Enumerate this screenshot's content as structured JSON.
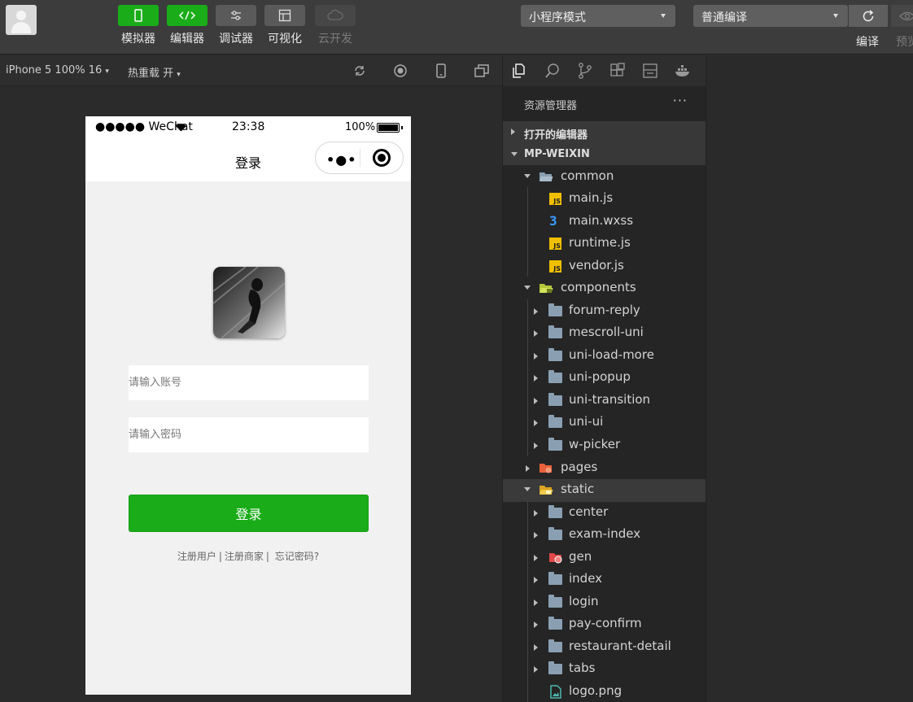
{
  "toolbar": {
    "buttons": [
      {
        "label": "模拟器"
      },
      {
        "label": "编辑器"
      },
      {
        "label": "调试器"
      },
      {
        "label": "可视化"
      },
      {
        "label": "云开发"
      }
    ],
    "mode_select": "小程序模式",
    "compile_select": "普通编译",
    "compile_label": "编译",
    "preview_label": "预览"
  },
  "simbar": {
    "device": "iPhone 5 100% 16",
    "hot_reload": "热重载 开"
  },
  "phone": {
    "status": {
      "carrier": "●●●●● WeChat",
      "time": "23:38",
      "battery": "100%"
    },
    "nav_title": "登录",
    "account_placeholder": "请输入账号",
    "password_placeholder": "请输入密码",
    "login_button": "登录",
    "links": [
      "注册用户",
      "注册商家",
      "忘记密码?"
    ]
  },
  "explorer": {
    "title": "资源管理器",
    "more": "···",
    "open_editors": "打开的编辑器",
    "project": "MP-WEIXIN",
    "tree": [
      {
        "name": "common"
      },
      {
        "name": "main.js"
      },
      {
        "name": "main.wxss"
      },
      {
        "name": "runtime.js"
      },
      {
        "name": "vendor.js"
      },
      {
        "name": "components"
      },
      {
        "name": "forum-reply"
      },
      {
        "name": "mescroll-uni"
      },
      {
        "name": "uni-load-more"
      },
      {
        "name": "uni-popup"
      },
      {
        "name": "uni-transition"
      },
      {
        "name": "uni-ui"
      },
      {
        "name": "w-picker"
      },
      {
        "name": "pages"
      },
      {
        "name": "static"
      },
      {
        "name": "center"
      },
      {
        "name": "exam-index"
      },
      {
        "name": "gen"
      },
      {
        "name": "index"
      },
      {
        "name": "login"
      },
      {
        "name": "pay-confirm"
      },
      {
        "name": "restaurant-detail"
      },
      {
        "name": "tabs"
      },
      {
        "name": "logo.png"
      }
    ]
  },
  "colors": {
    "accent_green": "#1aad19",
    "toolbar_bg": "#3c3c3c",
    "sidebar_bg": "#252526"
  }
}
